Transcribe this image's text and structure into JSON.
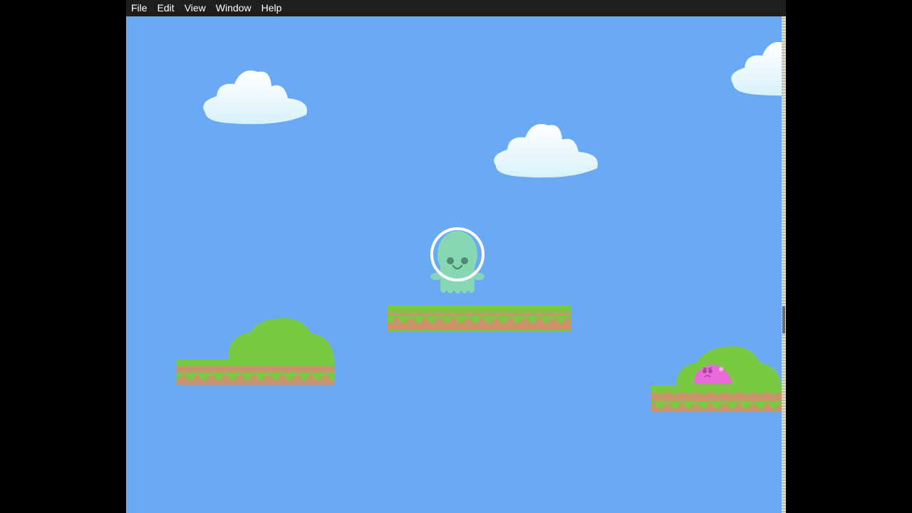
{
  "menu": {
    "items": [
      "File",
      "Edit",
      "View",
      "Window",
      "Help"
    ]
  },
  "scene": {
    "sky_color": "#6aaaf5",
    "grass_color": "#7ac943",
    "dirt_color": "#c8946a",
    "bush_color": "#7ac943",
    "player": {
      "name": "green-alien-astronaut",
      "body_color": "#86d8b4",
      "helmet_color": "#ffffff"
    },
    "enemy": {
      "name": "pink-slime",
      "color": "#e86ad8"
    }
  }
}
